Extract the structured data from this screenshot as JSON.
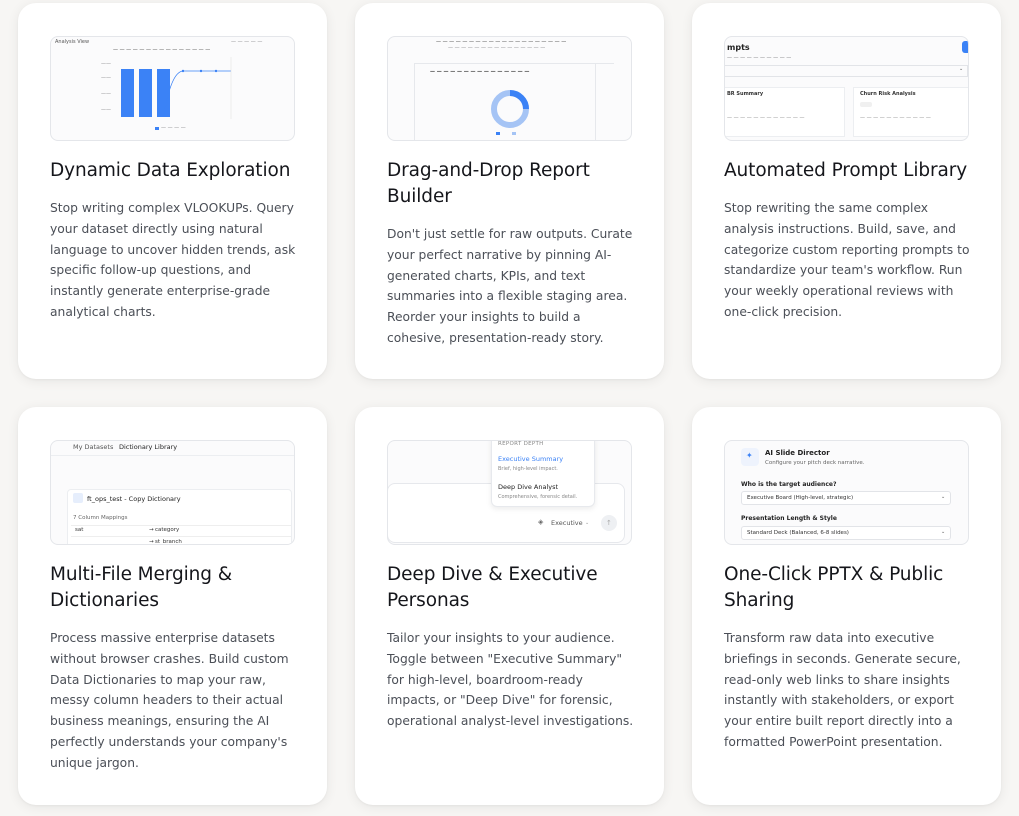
{
  "cards": [
    {
      "title": "Dynamic Data Exploration",
      "description": "Stop writing complex VLOOKUPs. Query your dataset directly using natural language to uncover hidden trends, ask specific follow-up questions, and instantly generate enterprise-grade analytical charts.",
      "thumb_icon": "bar-chart-preview"
    },
    {
      "title": "Drag-and-Drop Report Builder",
      "description": "Don't just settle for raw outputs. Curate your perfect narrative by pinning AI-generated charts, KPIs, and text summaries into a flexible staging area. Reorder your insights to build a cohesive, presentation-ready story.",
      "thumb_icon": "donut-chart-preview"
    },
    {
      "title": "Automated Prompt Library",
      "description": "Stop rewriting the same complex analysis instructions. Build, save, and categorize custom reporting prompts to standardize your team's workflow. Run your weekly operational reviews with one-click precision.",
      "thumb_icon": "prompt-library-preview",
      "thumb": {
        "heading": "mpts",
        "left_item": "BR Summary",
        "right_item": "Churn Risk Analysis"
      }
    },
    {
      "title": "Multi-File Merging & Dictionaries",
      "description": "Process massive enterprise datasets without browser crashes. Build custom Data Dictionaries to map your raw, messy column headers to their actual business meanings, ensuring the AI perfectly understands your company's unique jargon.",
      "thumb_icon": "dictionary-preview",
      "thumb": {
        "tab1": "My Datasets",
        "tab2": "Dictionary Library",
        "file": "ft_ops_test - Copy Dictionary",
        "mappings": "7 Column Mappings",
        "rows": [
          [
            "sat",
            "category"
          ],
          [
            "",
            "st_branch"
          ]
        ]
      }
    },
    {
      "title": "Deep Dive & Executive Personas",
      "description": "Tailor your insights to your audience. Toggle between \"Executive Summary\" for high-level, boardroom-ready impacts, or \"Deep Dive\" for forensic, operational analyst-level investigations.",
      "thumb_icon": "persona-dropdown-preview",
      "thumb": {
        "header": "REPORT DEPTH",
        "opt1": "Executive Summary",
        "opt1_sub": "Brief, high-level impact.",
        "opt2": "Deep Dive Analyst",
        "opt2_sub": "Comprehensive, forensic detail.",
        "selected": "Executive"
      }
    },
    {
      "title": "One-Click PPTX & Public Sharing",
      "description": "Transform raw data into executive briefings in seconds. Generate secure, read-only web links to share insights instantly with stakeholders, or export your entire built report directly into a formatted PowerPoint presentation.",
      "thumb_icon": "slide-director-preview",
      "thumb": {
        "title": "AI Slide Director",
        "subtitle": "Configure your pitch deck narrative.",
        "q1": "Who is the target audience?",
        "a1": "Executive Board (High-level, strategic)",
        "q2": "Presentation Length & Style",
        "a2": "Standard Deck (Balanced, 6-8 slides)"
      }
    }
  ],
  "colors": {
    "accent": "#3b82f6",
    "accent_light": "#a5c4f5",
    "background": "#f7f6f4",
    "card": "#ffffff"
  }
}
